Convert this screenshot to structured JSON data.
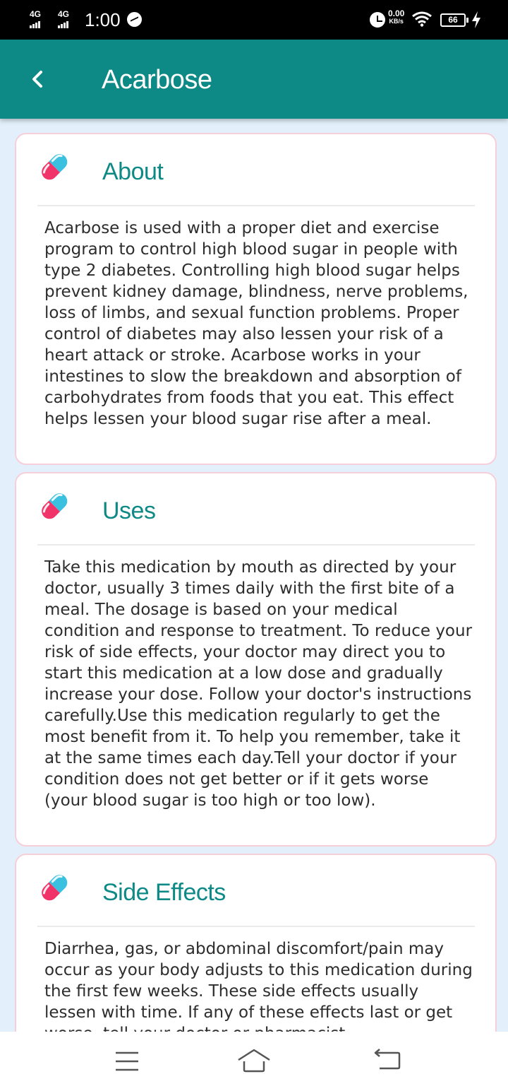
{
  "status_bar": {
    "network1": "4G",
    "network2": "4G",
    "time": "1:00",
    "speed_value": "0.00",
    "speed_unit": "KB/s",
    "battery": "66",
    "icons": [
      "signal-icon",
      "messenger-icon",
      "alarm-icon",
      "wifi-icon",
      "battery-icon",
      "charging-icon"
    ]
  },
  "app_bar": {
    "title": "Acarbose",
    "back_icon": "chevron-left-icon"
  },
  "cards": [
    {
      "title": "About",
      "icon": "capsule-icon",
      "body": "Acarbose is used with a proper diet and exercise program to control high blood sugar in people with type 2 diabetes. Controlling high blood sugar helps prevent kidney damage, blindness, nerve problems, loss of limbs, and sexual function problems. Proper control of diabetes may also lessen your risk of a heart attack or stroke. Acarbose works in your intestines to slow the breakdown and absorption of carbohydrates from foods that you eat. This effect helps lessen your blood sugar rise after a meal."
    },
    {
      "title": "Uses",
      "icon": "capsule-icon",
      "body": "Take this medication by mouth as directed by your doctor, usually 3 times daily with the first bite of a meal. The dosage is based on your medical condition and response to treatment. To reduce your risk of side effects, your doctor may direct you to start this medication at a low dose and gradually increase your dose. Follow your doctor's instructions carefully.Use this medication regularly to get the most benefit from it. To help you remember, take it at the same times each day.Tell your doctor if your condition does not get better or if it gets worse (your blood sugar is too high or too low)."
    },
    {
      "title": "Side Effects",
      "icon": "capsule-icon",
      "body": "Diarrhea, gas, or abdominal discomfort/pain may occur as your body adjusts to this medication during the first few weeks. These side effects usually lessen with time. If any of these effects last or get worse, tell your doctor or pharmacist"
    }
  ],
  "colors": {
    "primary": "#0e8a86",
    "background": "#e3f0fb",
    "card_border": "#f6cfd9",
    "capsule_pink": "#f0346a",
    "capsule_blue": "#3bc1e0"
  },
  "nav_bar": {
    "icons": [
      "menu-icon",
      "home-icon",
      "back-icon"
    ]
  }
}
